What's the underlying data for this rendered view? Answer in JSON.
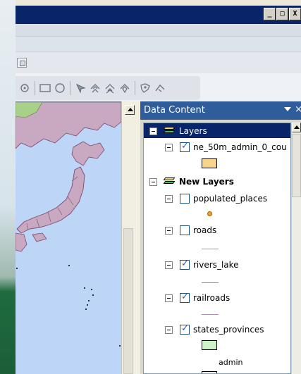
{
  "window": {
    "controls": {
      "minimize": "_",
      "maximize": "□",
      "close": "X"
    }
  },
  "toolbar": {
    "icons": [
      "rotate-icon",
      "rectangle-icon",
      "circle-icon",
      "select-feature-icon",
      "select-by-graphic-icon",
      "select-by-rect-icon",
      "select-by-polygon-icon",
      "identify-icon",
      "measure-icon"
    ]
  },
  "panel": {
    "title": "Data Content",
    "tree": {
      "group1": {
        "label": "Layers",
        "selected": true
      },
      "layer1": {
        "label": "ne_50m_admin_0_cou",
        "checked": true,
        "swatch": "#f9d58c"
      },
      "group2": {
        "label": "New Layers"
      },
      "layers": [
        {
          "label": "populated_places",
          "checked": false,
          "symbol": "dot",
          "color": "#f0a030"
        },
        {
          "label": "roads",
          "checked": false,
          "symbol": "line",
          "color": "#a884b0"
        },
        {
          "label": "rivers_lake",
          "checked": true,
          "symbol": "line",
          "color": "#b070b0"
        },
        {
          "label": "railroads",
          "checked": true,
          "symbol": "line",
          "color": "#b090b0"
        },
        {
          "label": "states_provinces",
          "checked": true,
          "symbol": "swatch",
          "color": "#cef2c8",
          "sublabel": "admin"
        }
      ]
    }
  },
  "colors": {
    "title_bar": "#0a246a",
    "panel_header": "#2f5c9a",
    "map_water": "#bdd6f7",
    "map_land": "#c9a8c2"
  }
}
